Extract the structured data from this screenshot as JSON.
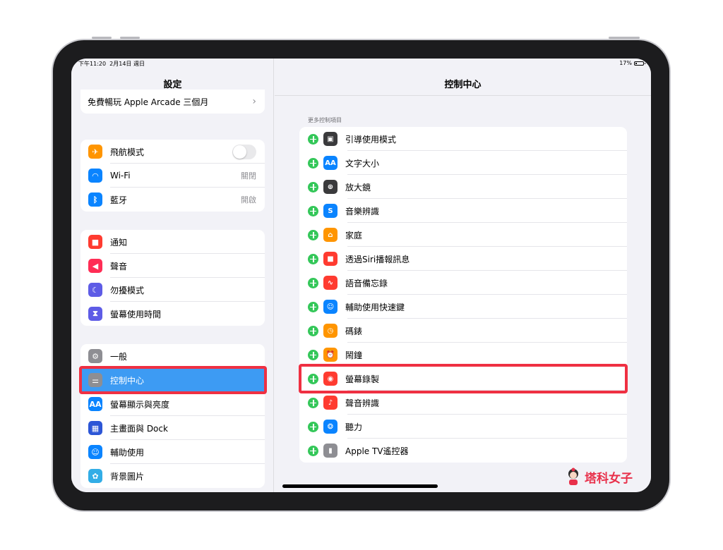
{
  "status_bar": {
    "time": "下午11:20",
    "date": "2月14日 週日",
    "battery_pct": "17%",
    "battery_level": 0.17
  },
  "sidebar": {
    "title": "設定",
    "promo": {
      "label": "免費暢玩 Apple Arcade 三個月"
    },
    "connectivity": [
      {
        "label": "飛航模式",
        "icon": "airplane-icon",
        "color": "#ff9500",
        "toggle_on": false
      },
      {
        "label": "Wi-Fi",
        "icon": "wifi-icon",
        "color": "#0a84ff",
        "value": "關閉"
      },
      {
        "label": "藍牙",
        "icon": "bluetooth-icon",
        "color": "#0a84ff",
        "value": "開啟"
      }
    ],
    "notifications": [
      {
        "label": "通知",
        "icon": "notification-icon",
        "color": "#ff3b30"
      },
      {
        "label": "聲音",
        "icon": "speaker-icon",
        "color": "#ff2d55"
      },
      {
        "label": "勿擾模式",
        "icon": "moon-icon",
        "color": "#5e5ce6"
      },
      {
        "label": "螢幕使用時間",
        "icon": "hourglass-icon",
        "color": "#5e5ce6"
      }
    ],
    "general": [
      {
        "label": "一般",
        "icon": "gear-icon",
        "color": "#8e8e93"
      },
      {
        "label": "控制中心",
        "icon": "switches-icon",
        "color": "#8e8e93",
        "selected": true
      },
      {
        "label": "螢幕顯示與亮度",
        "icon": "text-size-icon",
        "color": "#0a84ff",
        "icon_text": "AA"
      },
      {
        "label": "主畫面與 Dock",
        "icon": "home-grid-icon",
        "color": "#2c56d6"
      },
      {
        "label": "輔助使用",
        "icon": "accessibility-icon",
        "color": "#0a84ff"
      },
      {
        "label": "背景圖片",
        "icon": "wallpaper-icon",
        "color": "#32ade6"
      }
    ]
  },
  "detail": {
    "title": "控制中心",
    "section_header": "更多控制項目",
    "items": [
      {
        "label": "引導使用模式",
        "icon": "lock-icon",
        "color": "#3a3a3c"
      },
      {
        "label": "文字大小",
        "icon": "text-size-icon",
        "color": "#0a84ff",
        "icon_text": "AA"
      },
      {
        "label": "放大鏡",
        "icon": "magnifier-icon",
        "color": "#3a3a3c"
      },
      {
        "label": "音樂辨識",
        "icon": "shazam-icon",
        "color": "#0a84ff"
      },
      {
        "label": "家庭",
        "icon": "home-icon",
        "color": "#ff9500"
      },
      {
        "label": "透過Siri播報訊息",
        "icon": "siri-announce-icon",
        "color": "#ff3b30"
      },
      {
        "label": "語音備忘錄",
        "icon": "waveform-icon",
        "color": "#ff3b30"
      },
      {
        "label": "輔助使用快速鍵",
        "icon": "accessibility-icon",
        "color": "#0a84ff"
      },
      {
        "label": "碼錶",
        "icon": "stopwatch-icon",
        "color": "#ff9500"
      },
      {
        "label": "鬧鐘",
        "icon": "alarm-icon",
        "color": "#ff9500"
      },
      {
        "label": "螢幕錄製",
        "icon": "record-icon",
        "color": "#ff3b30"
      },
      {
        "label": "聲音辨識",
        "icon": "sound-recognition-icon",
        "color": "#ff3b30"
      },
      {
        "label": "聽力",
        "icon": "ear-icon",
        "color": "#0a84ff"
      },
      {
        "label": "Apple TV遙控器",
        "icon": "remote-icon",
        "color": "#8e8e93"
      }
    ]
  },
  "colors": {
    "highlight": "#ef3042",
    "selected": "#3d9bf3",
    "add": "#34c759"
  },
  "watermark": {
    "text": "塔科女子"
  }
}
